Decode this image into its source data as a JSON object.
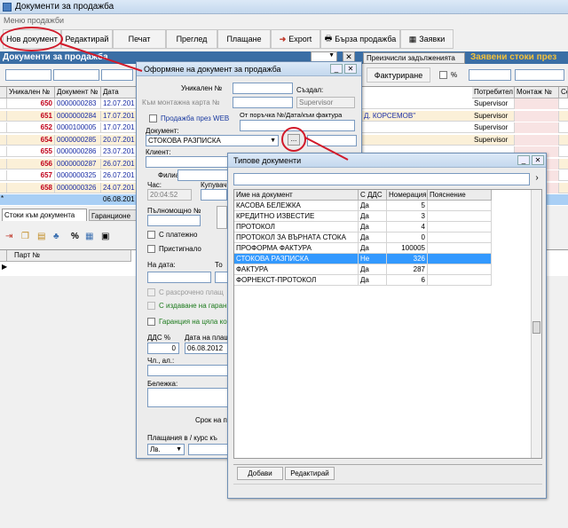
{
  "window": {
    "title": "Документи за продажба",
    "menu": "Меню продажби"
  },
  "toolbar": {
    "new_doc": "Нов документ",
    "edit": "Редактирай",
    "print": "Печат",
    "review": "Преглед",
    "payment": "Плащане",
    "export": "Export",
    "quick_sale": "Бърза продажба",
    "requests": "Заявки"
  },
  "main": {
    "header": "Документи за продажба",
    "recalc_btn": "Преизчисли задълженията",
    "stock_banner": "Заявени стоки през",
    "invoicing_btn": "Фактуриране",
    "percent": "%",
    "columns": [
      "Уникален №",
      "Документ №",
      "Дата"
    ],
    "right_columns": [
      "Потребител",
      "Монтаж №",
      "Се"
    ],
    "rows": [
      {
        "uid": "650",
        "doc": "0000000283",
        "date": "12.07.201",
        "user": "Supervisor"
      },
      {
        "uid": "651",
        "doc": "0000000284",
        "date": "17.07.201",
        "user": "Supervisor",
        "extra": "Д. КОРСЕМОВ\""
      },
      {
        "uid": "652",
        "doc": "0000100005",
        "date": "17.07.201",
        "user": "Supervisor"
      },
      {
        "uid": "654",
        "doc": "0000000285",
        "date": "20.07.201",
        "user": "Supervisor"
      },
      {
        "uid": "655",
        "doc": "0000000286",
        "date": "23.07.201",
        "user": ""
      },
      {
        "uid": "656",
        "doc": "0000000287",
        "date": "26.07.201",
        "user": ""
      },
      {
        "uid": "657",
        "doc": "0000000325",
        "date": "26.07.201",
        "user": ""
      },
      {
        "uid": "658",
        "doc": "0000000326",
        "date": "24.07.201",
        "user": ""
      }
    ],
    "new_row_date": "06.08.201",
    "tabs": [
      "Стоки към документа",
      "Гаранционе"
    ],
    "lower_col": "Парт №"
  },
  "dialog": {
    "title": "Оформяне на документ за продажба",
    "uid_label": "Уникален №",
    "created_label": "Създал:",
    "mount_card_label": "Към монтажна карта №",
    "created_value": "Supervisor",
    "web_sale": "Продажба през WEB",
    "order_ref_label": "От поръчка №/Дата/към фактура",
    "doc_label": "Документ:",
    "doc_value": "СТОКОВА РАЗПИСКА",
    "ellipsis": "...",
    "client_label": "Клиент:",
    "branch_label": "Филиал:",
    "time_label": "Час:",
    "time_value": "20:04:52",
    "buyer_label": "Купувач",
    "proxy_label": "Пълномощно №",
    "paid_label": "С платежно",
    "arrived_label": "Пристигнало",
    "on_date_label": "На дата:",
    "to_label": "То",
    "installment_label": "С разсрочено плащ",
    "guarantee_label": "С издаване на гаран",
    "full_guarantee_label": "Гаранция на цяла ко",
    "vat_label": "ДДС %",
    "vat_value": "0",
    "payment_date_label": "Дата на плащ",
    "payment_date_value": "06.08.2012",
    "article_label": "Чл., ал.:",
    "note_label": "Бележка:",
    "term_label": "Срок на п",
    "payment_currency_label": "Плащания в / курс къ",
    "currency_value": "Лв."
  },
  "types": {
    "title": "Типове документи",
    "columns": [
      "Име на документ",
      "С ДДС",
      "Номерация",
      "Пояснение"
    ],
    "rows": [
      {
        "name": "КАСОВА БЕЛЕЖКА",
        "vat": "Да",
        "num": "5"
      },
      {
        "name": "КРЕДИТНО ИЗВЕСТИЕ",
        "vat": "Да",
        "num": "3"
      },
      {
        "name": "ПРОТОКОЛ",
        "vat": "Да",
        "num": "4"
      },
      {
        "name": "ПРОТОКОЛ ЗА ВЪРНАТА СТОКА",
        "vat": "Да",
        "num": "0"
      },
      {
        "name": "ПРОФОРМА ФАКТУРА",
        "vat": "Да",
        "num": "100005"
      },
      {
        "name": "СТОКОВА РАЗПИСКА",
        "vat": "Не",
        "num": "326"
      },
      {
        "name": "ФАКТУРА",
        "vat": "Да",
        "num": "287"
      },
      {
        "name": "ФОРНЕКСТ-ПРОТОКОЛ",
        "vat": "Да",
        "num": "6"
      }
    ],
    "selected_index": 5,
    "add_btn": "Добави",
    "edit_btn": "Редактирай"
  },
  "colors": {
    "accent": "#d11a2a",
    "header_blue": "#3a6ea5",
    "select": "#3399ff"
  }
}
